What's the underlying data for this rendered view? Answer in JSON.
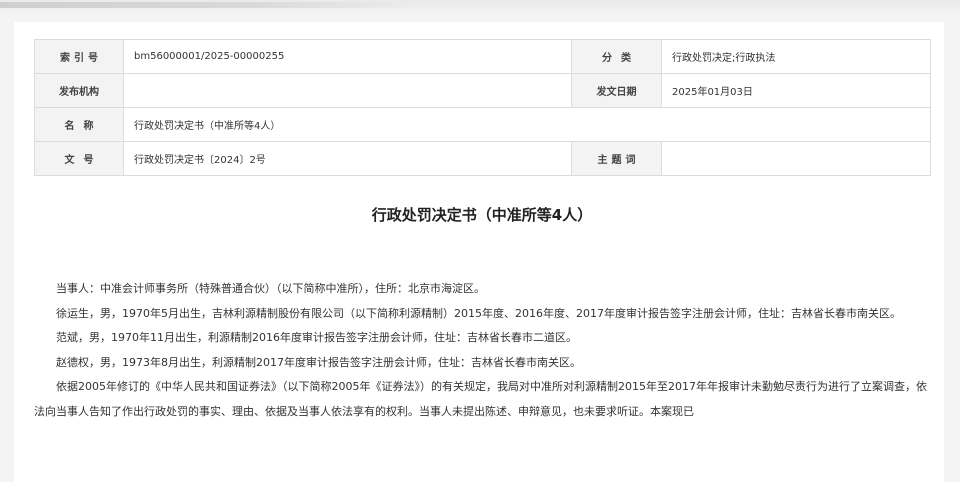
{
  "meta": {
    "index_label": "索引号",
    "index_value": "bm56000001/2025-00000255",
    "category_label": "分类",
    "category_value": "行政处罚决定;行政执法",
    "publisher_label": "发布机构",
    "publisher_value": "",
    "date_label": "发文日期",
    "date_value": "2025年01月03日",
    "name_label": "名称",
    "name_value": "行政处罚决定书（中准所等4人）",
    "docno_label": "文号",
    "docno_value": "行政处罚决定书〔2024〕2号",
    "subject_label": "主题词",
    "subject_value": ""
  },
  "document": {
    "title": "行政处罚决定书（中准所等4人）",
    "paragraphs": [
      "当事人：中准会计师事务所（特殊普通合伙）（以下简称中准所），住所：北京市海淀区。",
      "徐运生，男，1970年5月出生，吉林利源精制股份有限公司（以下简称利源精制）2015年度、2016年度、2017年度审计报告签字注册会计师，住址：吉林省长春市南关区。",
      "范斌，男，1970年11月出生，利源精制2016年度审计报告签字注册会计师，住址：吉林省长春市二道区。",
      "赵德权，男，1973年8月出生，利源精制2017年度审计报告签字注册会计师，住址：吉林省长春市南关区。",
      "依据2005年修订的《中华人民共和国证券法》（以下简称2005年《证券法》）的有关规定，我局对中准所对利源精制2015年至2017年年报审计未勤勉尽责行为进行了立案调查，依法向当事人告知了作出行政处罚的事实、理由、依据及当事人依法享有的权利。当事人未提出陈述、申辩意见，也未要求听证。本案现已"
    ]
  }
}
